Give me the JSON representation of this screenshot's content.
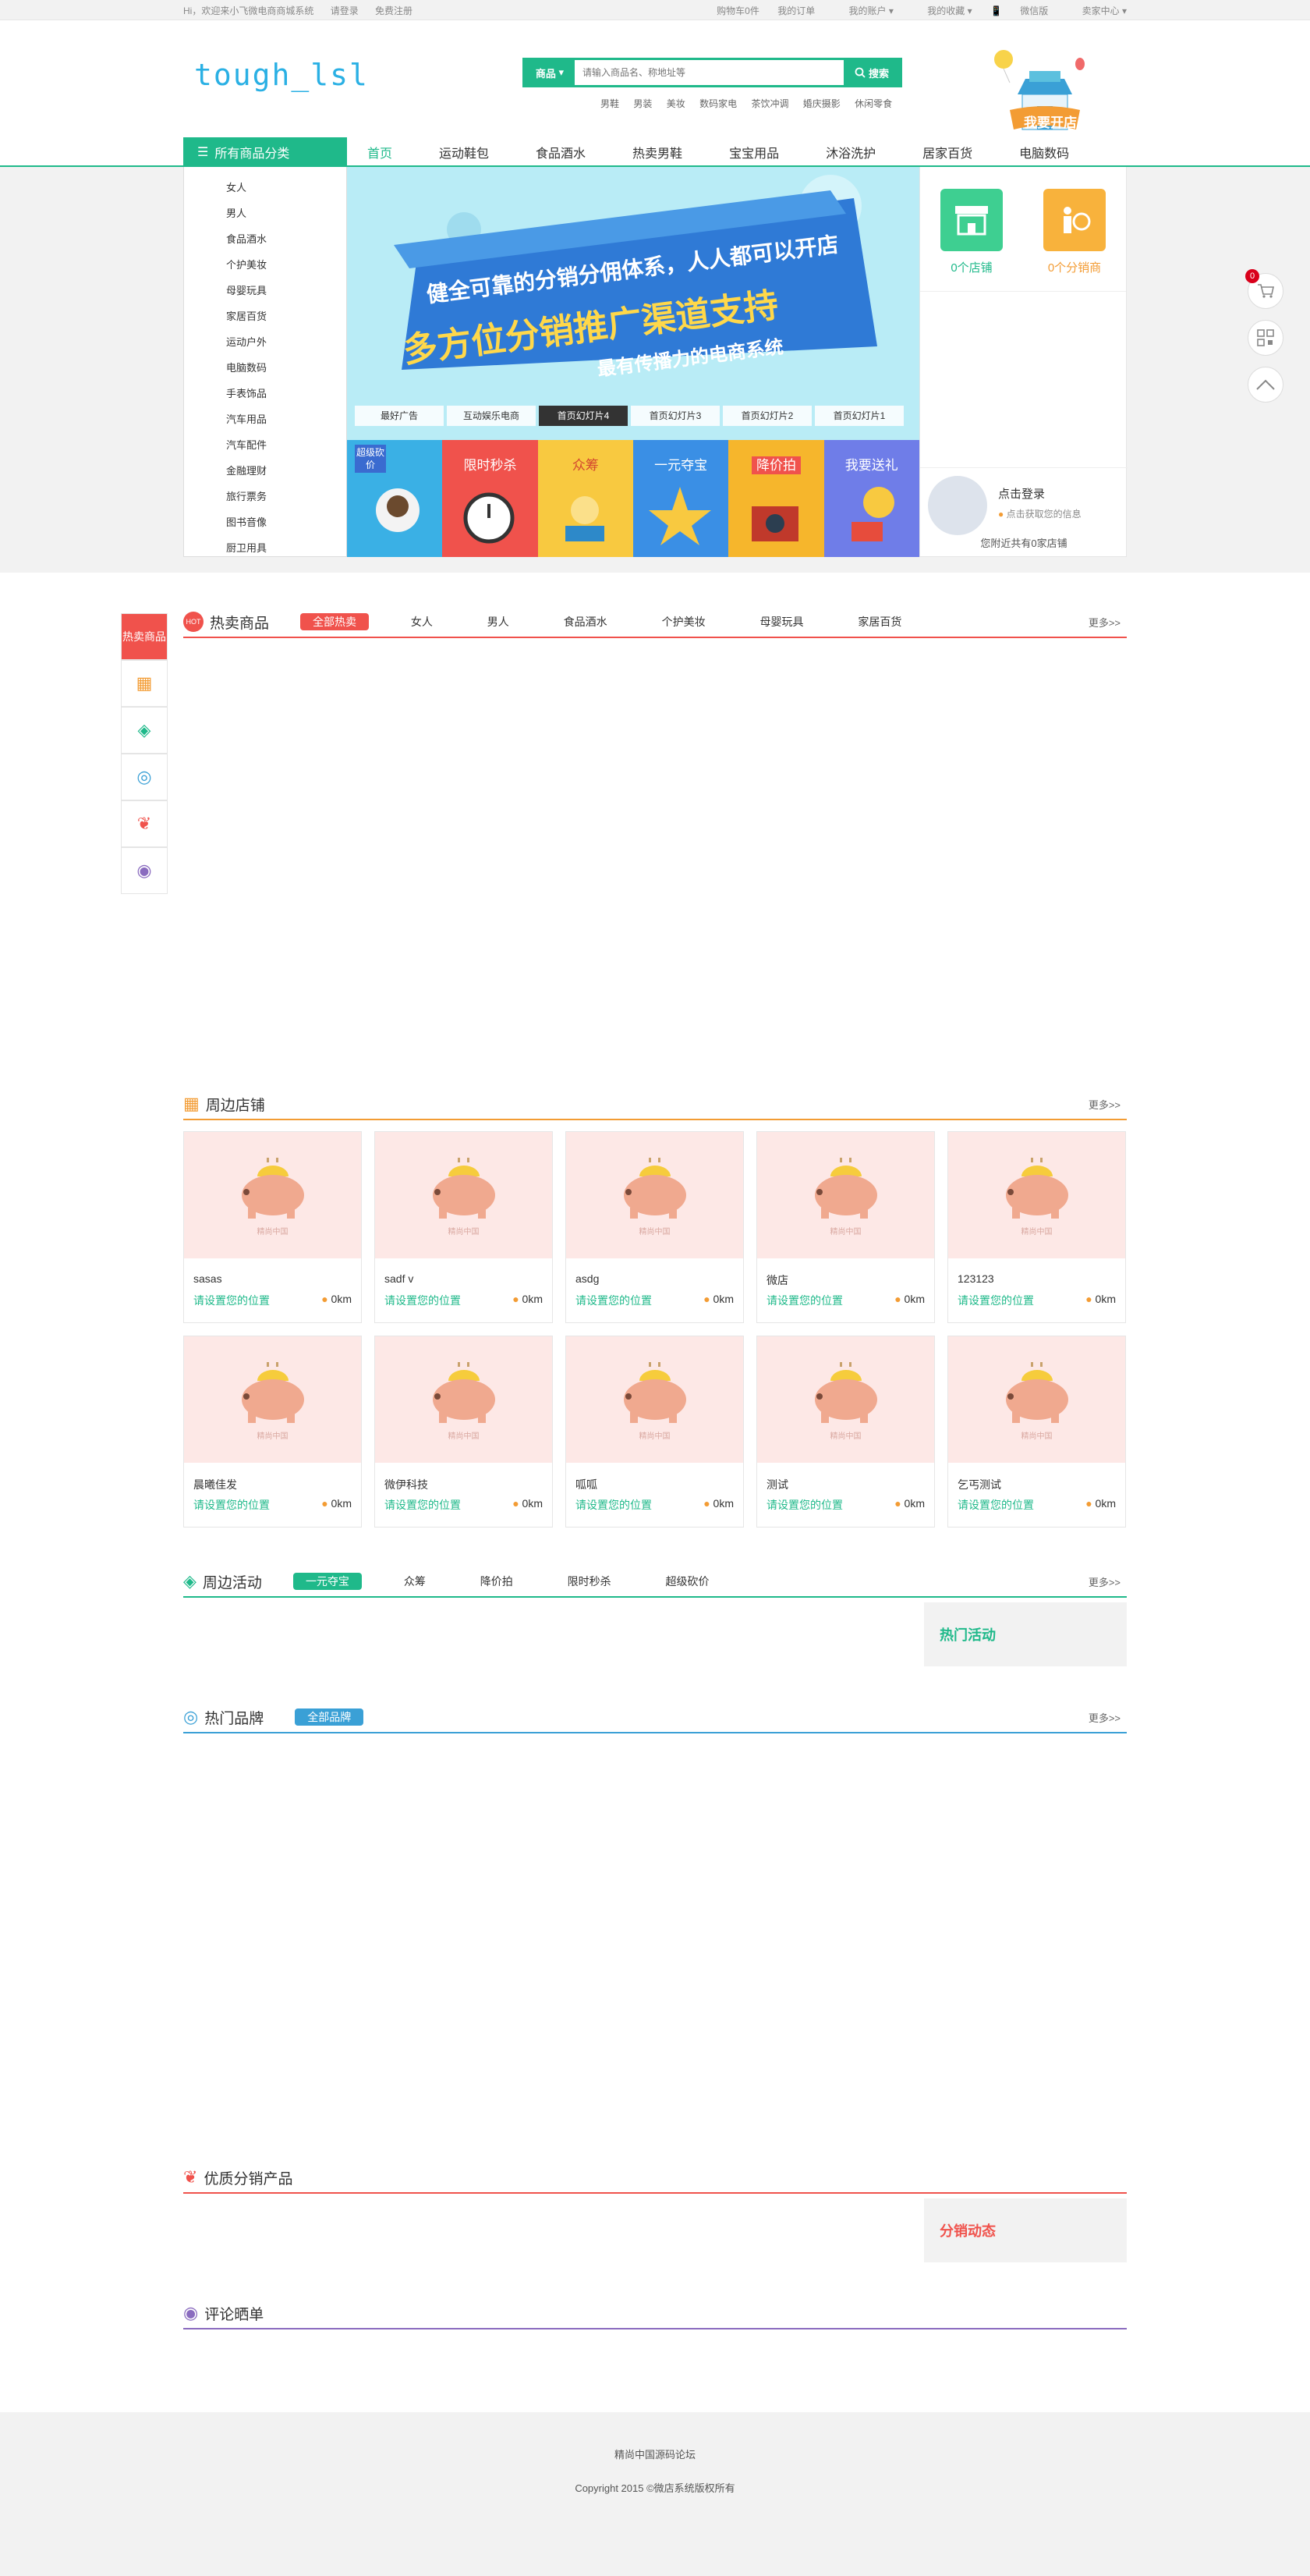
{
  "topbar": {
    "welcome": "Hi，欢迎来小飞微电商商城系统",
    "login": "请登录",
    "register": "免费注册",
    "cart": "购物车0件",
    "orders": "我的订单",
    "account": "我的账户",
    "favorites": "我的收藏",
    "mobile": "微信版",
    "seller": "卖家中心"
  },
  "header": {
    "logo": "tough_lsl",
    "search_category": "商品",
    "search_placeholder": "请输入商品名、称地址等",
    "search_button": "搜索",
    "hotwords": [
      "男鞋",
      "男装",
      "美妆",
      "数码家电",
      "茶饮冲调",
      "婚庆摄影",
      "休闲零食"
    ],
    "openshop": "我要开店"
  },
  "nav": {
    "all_categories": "所有商品分类",
    "links": [
      "首页",
      "运动鞋包",
      "食品酒水",
      "热卖男鞋",
      "宝宝用品",
      "沐浴洗护",
      "居家百货",
      "电脑数码"
    ]
  },
  "categories": [
    "女人",
    "男人",
    "食品酒水",
    "个护美妆",
    "母婴玩具",
    "家居百货",
    "运动户外",
    "电脑数码",
    "手表饰品",
    "汽车用品",
    "汽车配件",
    "金融理财",
    "旅行票务",
    "图书音像",
    "厨卫用具"
  ],
  "banner": {
    "line1": "健全可靠的分销分佣体系，人人都可以开店",
    "line2": "多方位分销推广渠道支持",
    "line3": "最有传播力的电商系统",
    "tabs": [
      "最好广告",
      "互动娱乐电商",
      "首页幻灯片4",
      "首页幻灯片3",
      "首页幻灯片2",
      "首页幻灯片1"
    ]
  },
  "promo": [
    {
      "label": "超级砍价",
      "color": "#3ab0e5"
    },
    {
      "label": "限时秒杀",
      "color": "#f0524c"
    },
    {
      "label": "众筹",
      "color": "#f8c940"
    },
    {
      "label": "一元夺宝",
      "color": "#3a8fe5"
    },
    {
      "label": "降价拍",
      "color": "#f6b62c"
    },
    {
      "label": "我要送礼",
      "color": "#6f7de8"
    }
  ],
  "rightbox": {
    "stores": "0个店铺",
    "distributors": "0个分销商",
    "login_title": "点击登录",
    "login_info": "点击获取您的信息",
    "nearby": "您附近共有0家店铺"
  },
  "sidefloat": {
    "cart_count": "0"
  },
  "floornav": {
    "hot": "热卖商品"
  },
  "hot_goods": {
    "title": "热卖商品",
    "tabs": [
      "全部热卖",
      "女人",
      "男人",
      "食品酒水",
      "个护美妆",
      "母婴玩具",
      "家居百货"
    ],
    "more": "更多>>"
  },
  "nearby_stores": {
    "title": "周边店铺",
    "more": "更多>>",
    "image_caption": "精尚中国",
    "items": [
      {
        "name": "sasas",
        "loc": "请设置您的位置",
        "dist": "0km"
      },
      {
        "name": "sadf v",
        "loc": "请设置您的位置",
        "dist": "0km"
      },
      {
        "name": "asdg",
        "loc": "请设置您的位置",
        "dist": "0km"
      },
      {
        "name": "微店",
        "loc": "请设置您的位置",
        "dist": "0km"
      },
      {
        "name": "123123",
        "loc": "请设置您的位置",
        "dist": "0km"
      },
      {
        "name": "晨曦佳发",
        "loc": "请设置您的位置",
        "dist": "0km"
      },
      {
        "name": "微伊科技",
        "loc": "请设置您的位置",
        "dist": "0km"
      },
      {
        "name": "呱呱",
        "loc": "请设置您的位置",
        "dist": "0km"
      },
      {
        "name": "测试",
        "loc": "请设置您的位置",
        "dist": "0km"
      },
      {
        "name": "乞丐测试",
        "loc": "请设置您的位置",
        "dist": "0km"
      }
    ]
  },
  "nearby_activity": {
    "title": "周边活动",
    "tabs": [
      "一元夺宝",
      "众筹",
      "降价拍",
      "限时秒杀",
      "超级砍价"
    ],
    "more": "更多>>",
    "side": "热门活动"
  },
  "brands": {
    "title": "热门品牌",
    "tab": "全部品牌",
    "more": "更多>>"
  },
  "distribution": {
    "title": "优质分销产品",
    "side": "分销动态"
  },
  "reviews": {
    "title": "评论晒单"
  },
  "footer": {
    "forum": "精尚中国源码论坛",
    "copyright": "Copyright 2015 ©微店系统版权所有"
  },
  "colors": {
    "green": "#1fb98a",
    "red": "#f0524c",
    "orange": "#f39c34",
    "blue": "#3aa0d6",
    "purple": "#8a6bbf"
  }
}
